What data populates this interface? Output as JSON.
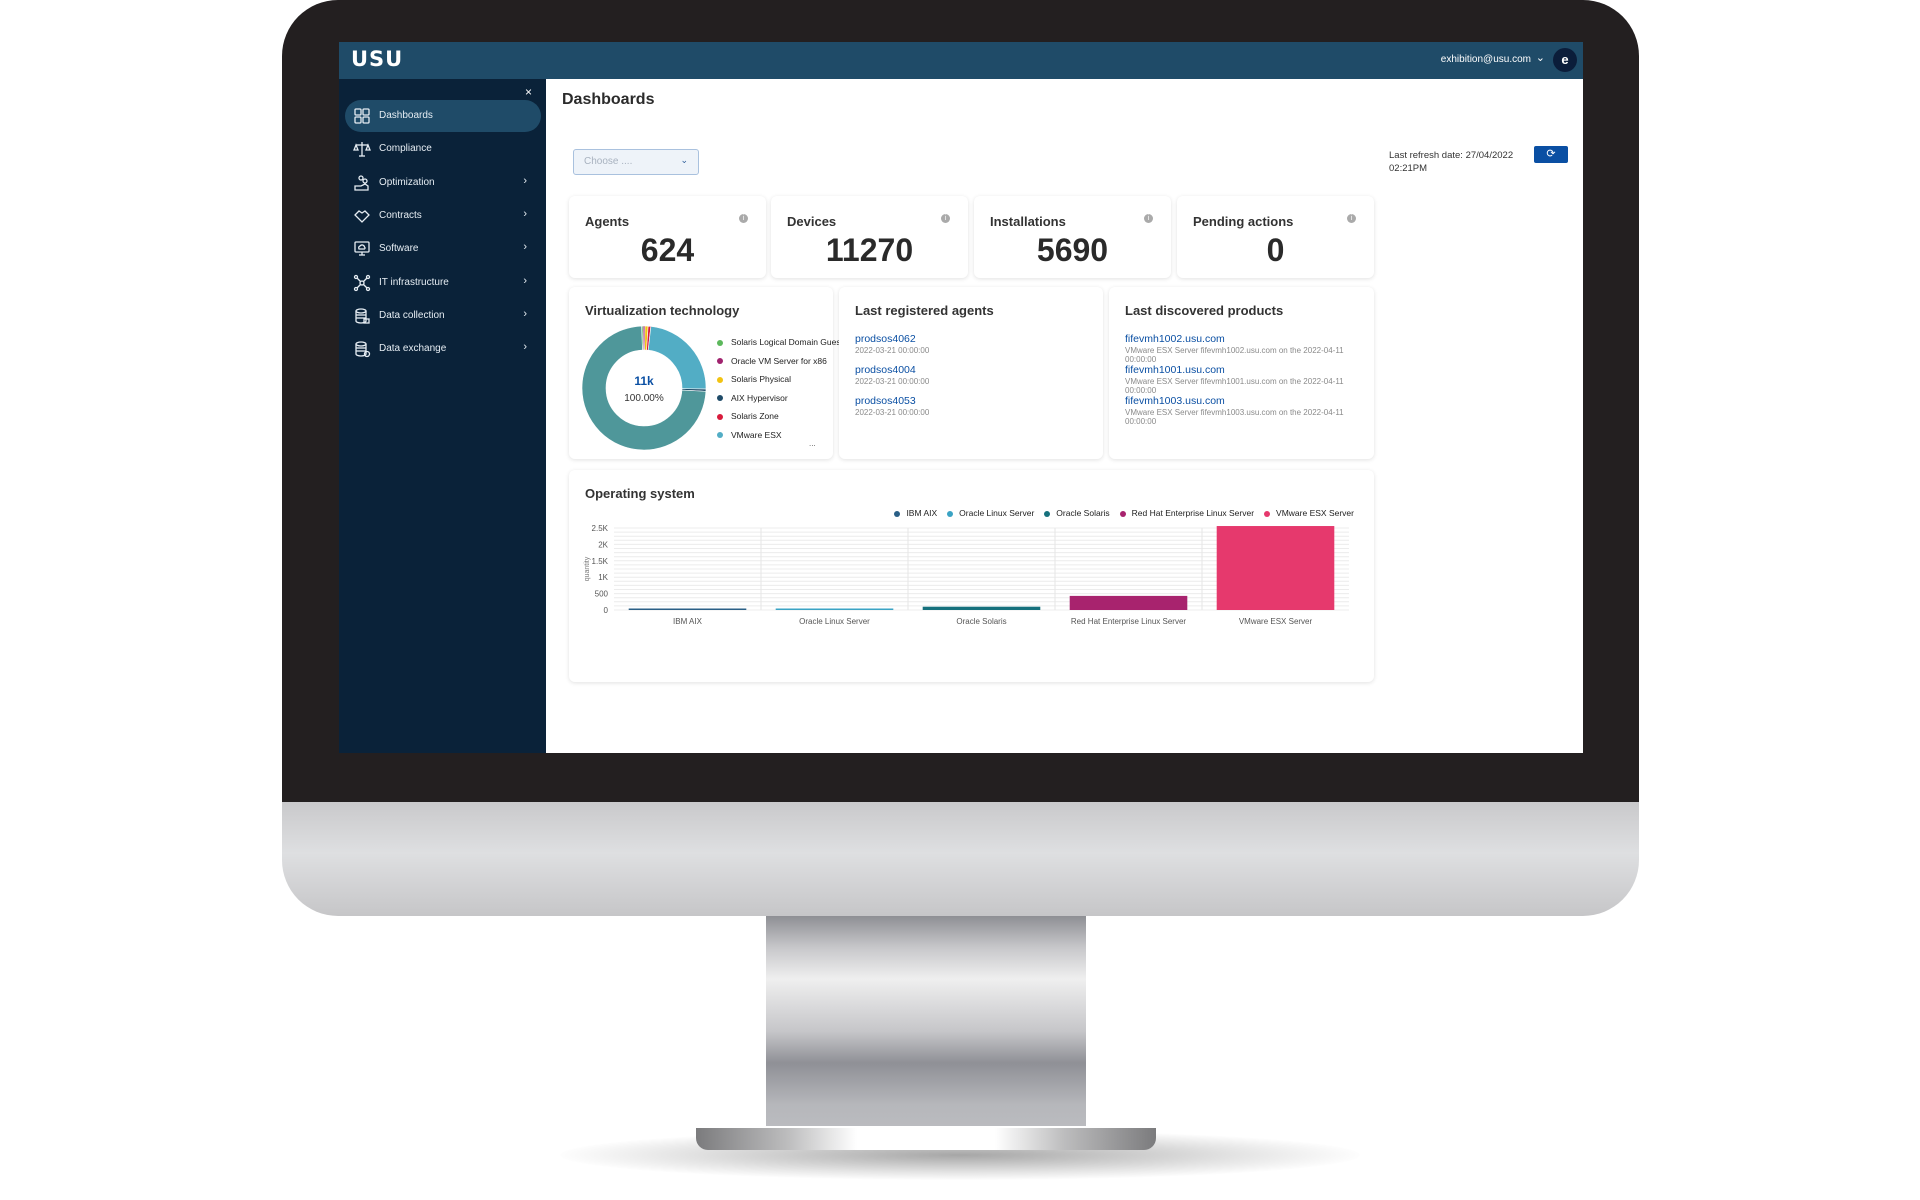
{
  "app": {
    "logo": "USU",
    "user_email": "exhibition@usu.com",
    "user_chevron": "⌄",
    "avatar_initial": "e",
    "sidebar_close": "×"
  },
  "sidebar": {
    "items": [
      {
        "label": "Dashboards",
        "icon": "dashboard-grid-icon",
        "active": true,
        "has_children": false
      },
      {
        "label": "Compliance",
        "icon": "scales-icon",
        "active": false,
        "has_children": false
      },
      {
        "label": "Optimization",
        "icon": "hand-coins-icon",
        "active": false,
        "has_children": true
      },
      {
        "label": "Contracts",
        "icon": "handshake-icon",
        "active": false,
        "has_children": true
      },
      {
        "label": "Software",
        "icon": "monitor-cloud-icon",
        "active": false,
        "has_children": true
      },
      {
        "label": "IT infrastructure",
        "icon": "network-nodes-icon",
        "active": false,
        "has_children": true
      },
      {
        "label": "Data collection",
        "icon": "database-lock-icon",
        "active": false,
        "has_children": true
      },
      {
        "label": "Data exchange",
        "icon": "database-sync-icon",
        "active": false,
        "has_children": true
      }
    ],
    "chevron": "›"
  },
  "main": {
    "title": "Dashboards",
    "select_placeholder": "Choose ....",
    "select_chevron": "⌄",
    "refresh_label": "Last refresh date: 27/04/2022 02:21PM",
    "refresh_icon": "⟳"
  },
  "kpis": [
    {
      "title": "Agents",
      "value": "624"
    },
    {
      "title": "Devices",
      "value": "11270"
    },
    {
      "title": "Installations",
      "value": "5690"
    },
    {
      "title": "Pending actions",
      "value": "0"
    }
  ],
  "kpi_info_icon": "i",
  "panels": {
    "virtualization": {
      "title": "Virtualization technology",
      "center_value": "11k",
      "center_percent": "100.00%",
      "legend_more": "..."
    },
    "agents": {
      "title": "Last registered agents",
      "items": [
        {
          "name": "prodsos4062",
          "date": "2022-03-21 00:00:00"
        },
        {
          "name": "prodsos4004",
          "date": "2022-03-21 00:00:00"
        },
        {
          "name": "prodsos4053",
          "date": "2022-03-21 00:00:00"
        }
      ]
    },
    "products": {
      "title": "Last discovered products",
      "items": [
        {
          "name": "fifevmh1002.usu.com",
          "detail": "VMware ESX Server fifevmh1002.usu.com on the 2022-04-11 00:00:00"
        },
        {
          "name": "fifevmh1001.usu.com",
          "detail": "VMware ESX Server fifevmh1001.usu.com on the 2022-04-11 00:00:00"
        },
        {
          "name": "fifevmh1003.usu.com",
          "detail": "VMware ESX Server fifevmh1003.usu.com on the 2022-04-11 00:00:00"
        }
      ]
    },
    "os": {
      "title": "Operating system"
    }
  },
  "chart_data": [
    {
      "type": "pie",
      "title": "Virtualization technology",
      "donut": true,
      "center_label": "11k",
      "center_sublabel": "100.00%",
      "legend_placement": "right",
      "slices": [
        {
          "name": "Solaris Logical Domain Guest",
          "value": 0.4,
          "color": "#5cb85c"
        },
        {
          "name": "Oracle VM Server for x86",
          "value": 0.5,
          "color": "#a0226e"
        },
        {
          "name": "Solaris Physical",
          "value": 0.8,
          "color": "#f2c311"
        },
        {
          "name": "Solaris Zone",
          "value": 0.7,
          "color": "#d81b3c"
        },
        {
          "name": "VMware ESX",
          "value": 23.5,
          "color": "#52adc5"
        },
        {
          "name": "AIX Hypervisor",
          "value": 0.6,
          "color": "#1f4b68"
        },
        {
          "name": "(other, not shown in legend)",
          "value": 73.5,
          "color": "#4f979a"
        }
      ],
      "legend": [
        {
          "name": "Solaris Logical Domain Guest",
          "color": "#5cb85c"
        },
        {
          "name": "Oracle VM Server for x86",
          "color": "#a0226e"
        },
        {
          "name": "Solaris Physical",
          "color": "#f2c311"
        },
        {
          "name": "AIX Hypervisor",
          "color": "#1f4b68"
        },
        {
          "name": "Solaris Zone",
          "color": "#d81b3c"
        },
        {
          "name": "VMware ESX",
          "color": "#52adc5"
        }
      ]
    },
    {
      "type": "bar",
      "title": "Operating system",
      "xlabel": "",
      "ylabel": "quantity",
      "ylim": [
        0,
        2500
      ],
      "yticks": [
        0,
        500,
        1000,
        1500,
        2000,
        2500
      ],
      "ytick_labels": [
        "0",
        "500",
        "1K",
        "1.5K",
        "2K",
        "2.5K"
      ],
      "grid": true,
      "legend_placement": "top-right",
      "categories": [
        "IBM AIX",
        "Oracle Linux Server",
        "Oracle Solaris",
        "Red Hat Enterprise Linux Server",
        "VMware ESX Server"
      ],
      "values": [
        20,
        20,
        100,
        430,
        2560
      ],
      "colors": [
        "#2a5f86",
        "#3aa3c4",
        "#16717d",
        "#a8236e",
        "#e6396d"
      ]
    }
  ]
}
